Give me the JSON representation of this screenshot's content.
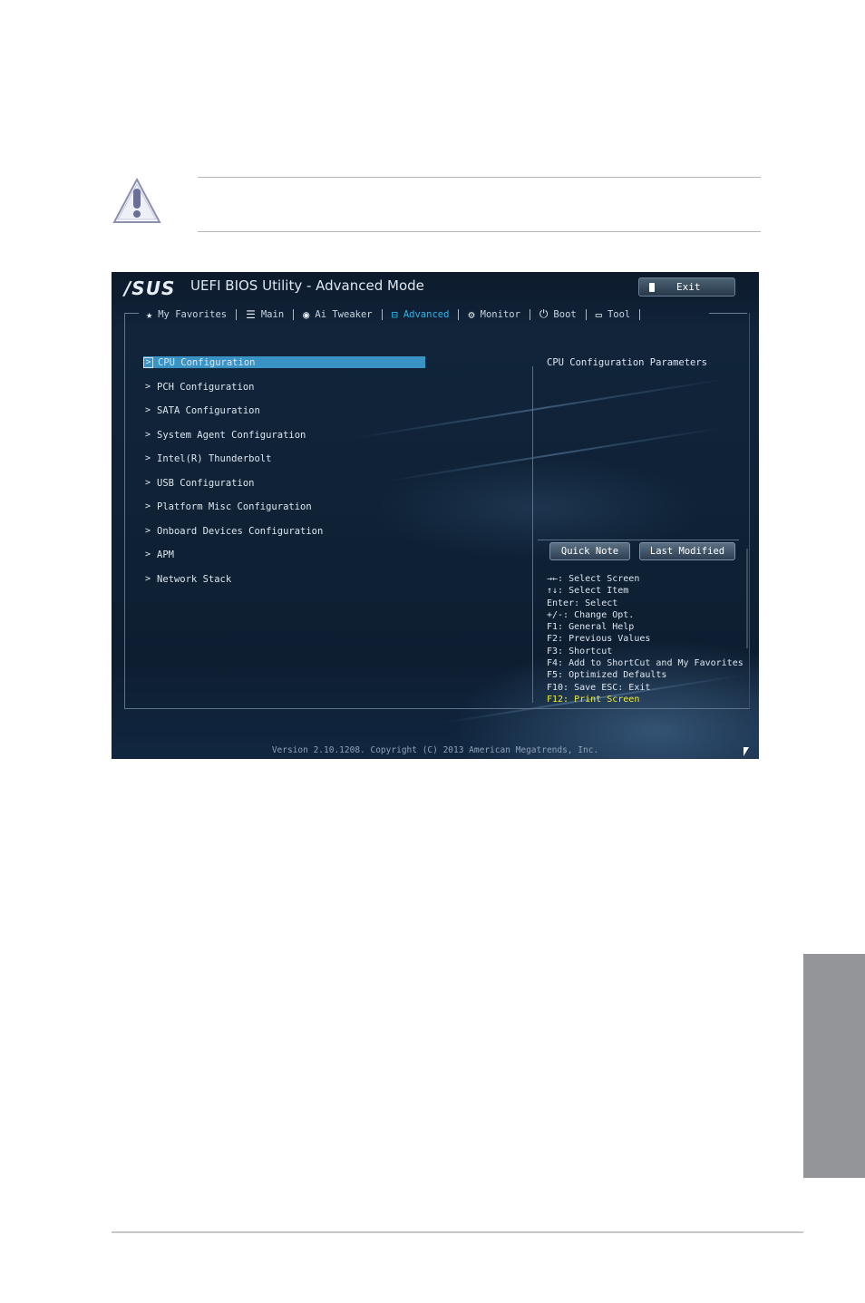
{
  "caution": {
    "icon": "caution-triangle-icon"
  },
  "bios": {
    "logo": "/SUS",
    "title": "UEFI BIOS Utility - Advanced Mode",
    "exit_label": "Exit",
    "tabs": [
      {
        "label": "My Favorites",
        "icon": "star-icon",
        "active": false
      },
      {
        "label": "Main",
        "icon": "list-icon",
        "active": false
      },
      {
        "label": "Ai Tweaker",
        "icon": "tweaker-icon",
        "active": false
      },
      {
        "label": "Advanced",
        "icon": "advanced-icon",
        "active": true
      },
      {
        "label": "Monitor",
        "icon": "monitor-icon",
        "active": false
      },
      {
        "label": "Boot",
        "icon": "power-icon",
        "active": false
      },
      {
        "label": "Tool",
        "icon": "tool-icon",
        "active": false
      }
    ],
    "menu": [
      {
        "label": "CPU Configuration",
        "selected": true
      },
      {
        "label": "PCH Configuration",
        "selected": false
      },
      {
        "label": "SATA Configuration",
        "selected": false
      },
      {
        "label": "System Agent Configuration",
        "selected": false
      },
      {
        "label": "Intel(R) Thunderbolt",
        "selected": false
      },
      {
        "label": "USB Configuration",
        "selected": false
      },
      {
        "label": "Platform Misc Configuration",
        "selected": false
      },
      {
        "label": "Onboard Devices Configuration",
        "selected": false
      },
      {
        "label": "APM",
        "selected": false
      },
      {
        "label": "Network Stack",
        "selected": false
      }
    ],
    "help_title": "CPU Configuration Parameters",
    "quick_note_label": "Quick Note",
    "last_modified_label": "Last Modified",
    "keys": [
      "→←: Select Screen",
      "↑↓: Select Item",
      "Enter: Select",
      "+/-: Change Opt.",
      "F1: General Help",
      "F2: Previous Values",
      "F3: Shortcut",
      "F4: Add to ShortCut and My Favorites",
      "F5: Optimized Defaults",
      "F10: Save  ESC: Exit",
      "F12: Print Screen"
    ],
    "footer": "Version 2.10.1208. Copyright (C) 2013 American Megatrends, Inc.",
    "colors": {
      "accent": "#2fb4ea",
      "selected_bg": "#3a93c5",
      "highlight_key": "#f0ee35"
    }
  }
}
